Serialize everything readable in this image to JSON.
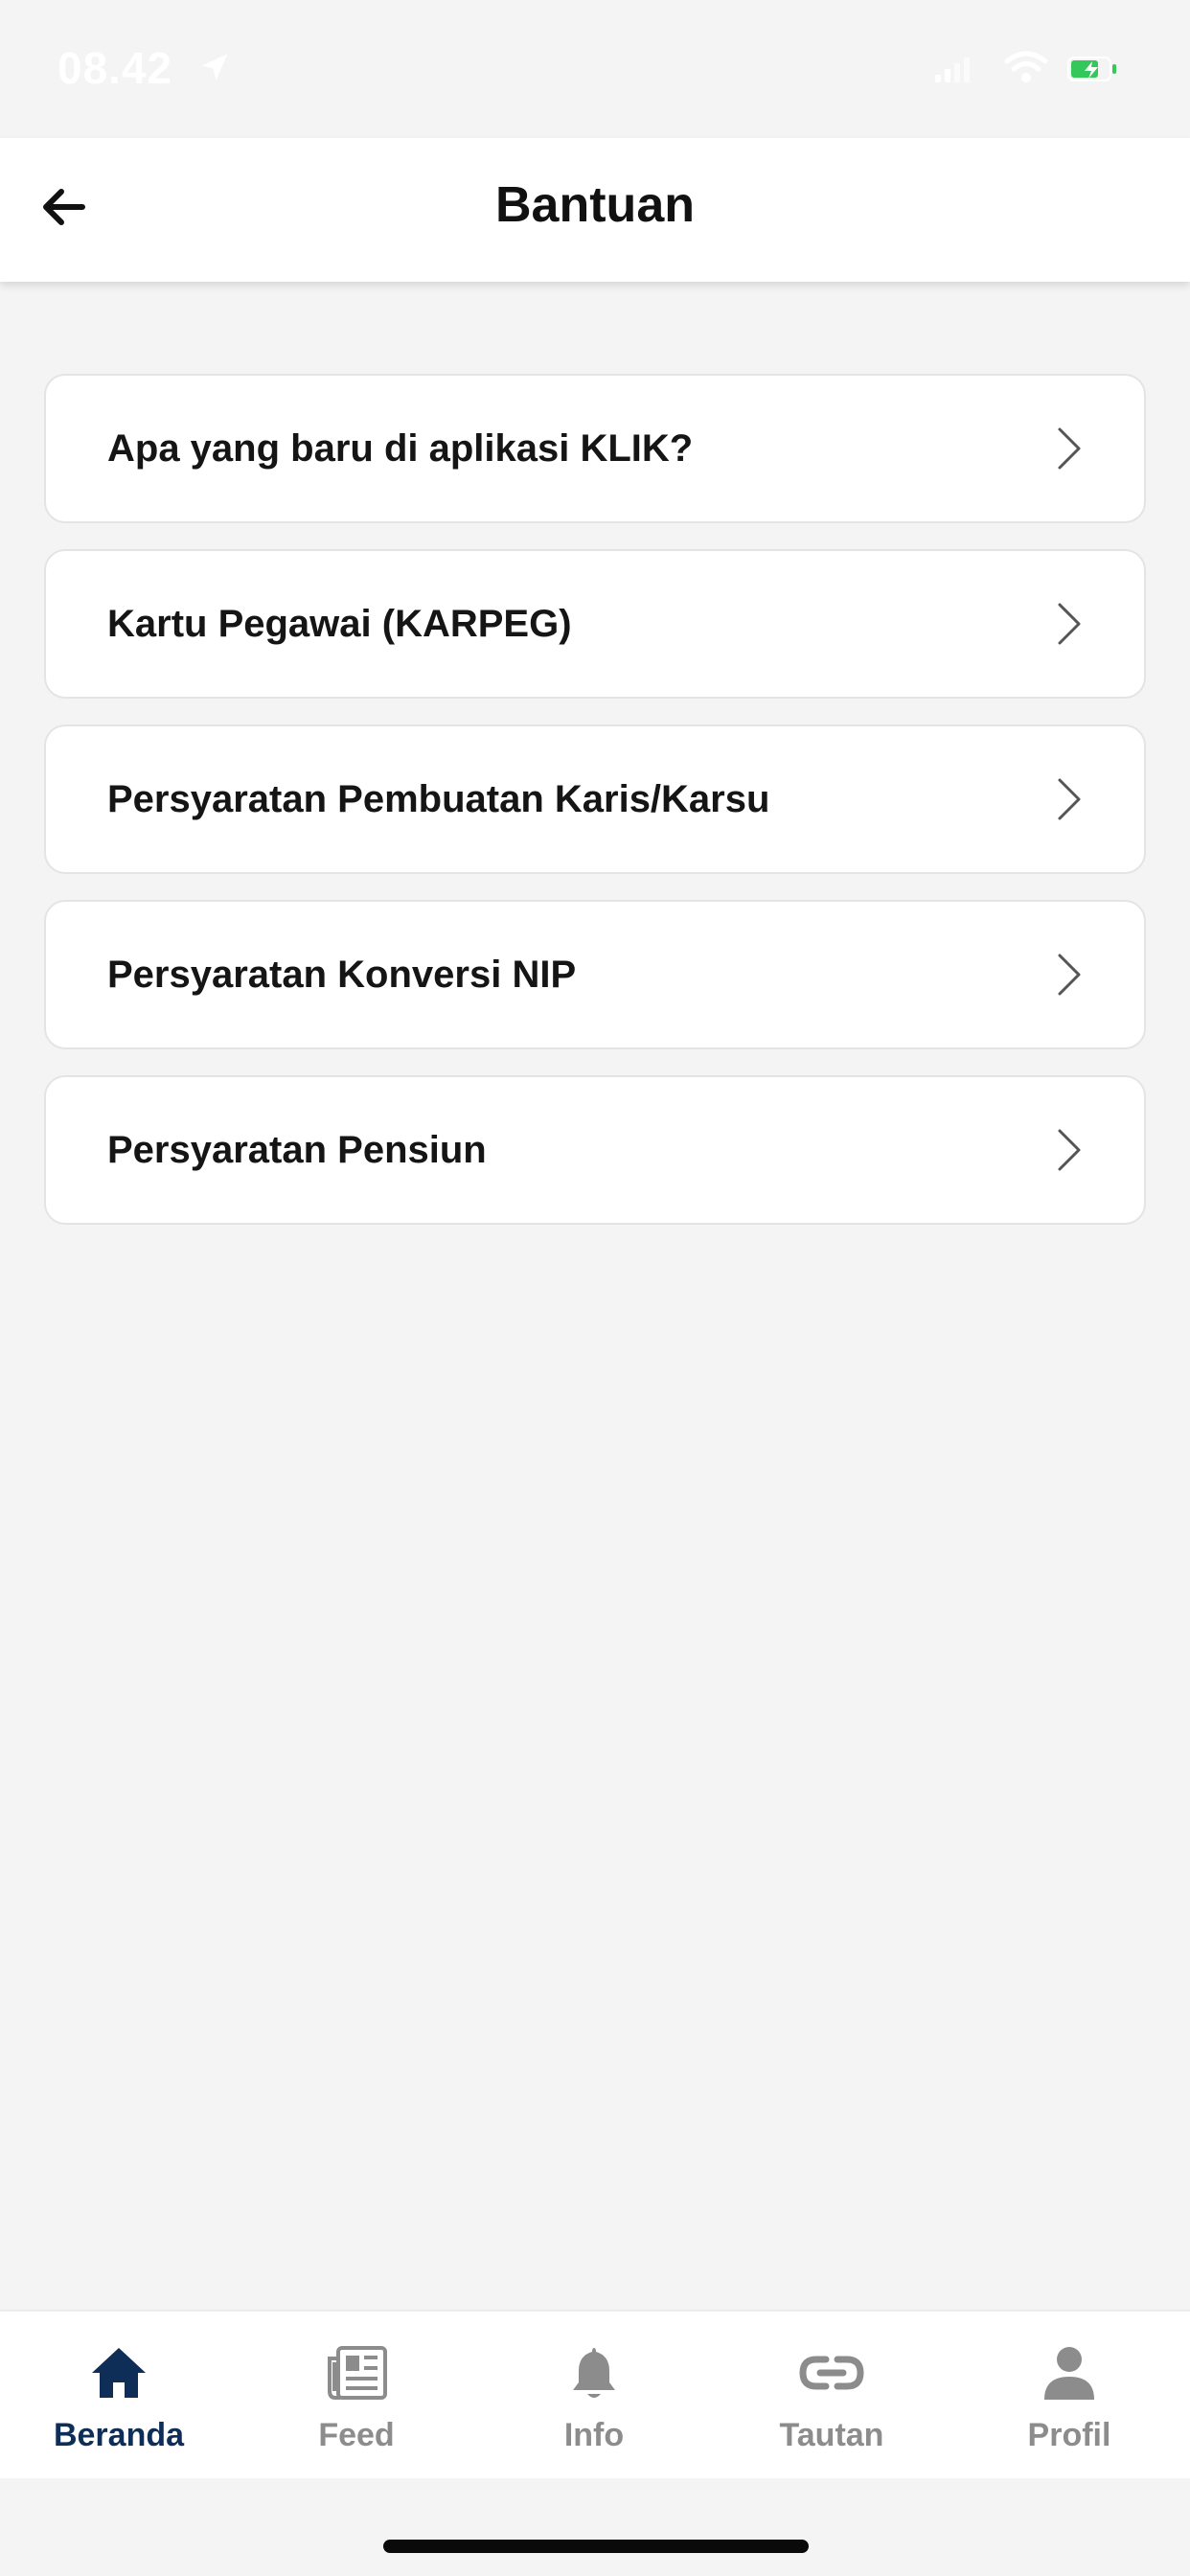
{
  "status_bar": {
    "time": "08.42",
    "icons": [
      "location-arrow-icon",
      "cellular-signal-icon",
      "wifi-icon",
      "battery-charging-icon"
    ],
    "battery_color": "#34c759"
  },
  "header": {
    "title": "Bantuan",
    "back_icon": "arrow-left-icon"
  },
  "menu": {
    "items": [
      {
        "label": "Apa yang baru di aplikasi KLIK?"
      },
      {
        "label": "Kartu Pegawai (KARPEG)"
      },
      {
        "label": "Persyaratan Pembuatan Karis/Karsu"
      },
      {
        "label": "Persyaratan Konversi NIP"
      },
      {
        "label": "Persyaratan Pensiun"
      }
    ],
    "item_icon": "chevron-right-icon"
  },
  "tab_bar": {
    "active_color": "#0f2e57",
    "inactive_color": "#8c8c8c",
    "tabs": [
      {
        "label": "Beranda",
        "icon": "home-icon",
        "active": true
      },
      {
        "label": "Feed",
        "icon": "newspaper-icon",
        "active": false
      },
      {
        "label": "Info",
        "icon": "bell-icon",
        "active": false
      },
      {
        "label": "Tautan",
        "icon": "link-icon",
        "active": false
      },
      {
        "label": "Profil",
        "icon": "user-icon",
        "active": false
      }
    ]
  }
}
